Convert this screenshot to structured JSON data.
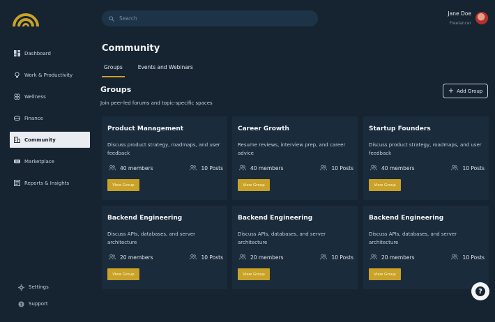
{
  "brand": {
    "accent": "#c9a227",
    "background": "#162432",
    "card": "#1a2b3b"
  },
  "sidebar": {
    "items": [
      {
        "label": "Dashboard",
        "icon": "dashboard-icon"
      },
      {
        "label": "Work & Productivity",
        "icon": "lightbulb-icon"
      },
      {
        "label": "Wellness",
        "icon": "wellness-icon"
      },
      {
        "label": "Finance",
        "icon": "finance-icon"
      },
      {
        "label": "Community",
        "icon": "community-icon"
      },
      {
        "label": "Marketplace",
        "icon": "marketplace-icon"
      },
      {
        "label": "Reports & Insights",
        "icon": "reports-icon"
      }
    ],
    "active": "Community",
    "bottom": [
      {
        "label": "Settings",
        "icon": "gear-icon"
      },
      {
        "label": "Support",
        "icon": "support-icon"
      }
    ]
  },
  "search": {
    "placeholder": "Search"
  },
  "user": {
    "name": "Jane Doe",
    "role": "Freelancer"
  },
  "page": {
    "title": "Community"
  },
  "tabs": [
    {
      "label": "Groups",
      "active": true
    },
    {
      "label": "Events and Webinars",
      "active": false
    }
  ],
  "section": {
    "title": "Groups",
    "subtitle": "Join peer-led forums and topic-specific spaces",
    "add_label": "Add Group"
  },
  "groups": [
    {
      "title": "Product Management",
      "description": "Discuss product strategy, roadmaps, and user feedback",
      "members": "40 members",
      "posts": "10 Posts",
      "button": "View Group"
    },
    {
      "title": "Career Growth",
      "description": "Resume reviews, interview prep, and career advice",
      "members": "40 members",
      "posts": "10 Posts",
      "button": "View Group"
    },
    {
      "title": "Startup Founders",
      "description": "Discuss product strategy, roadmaps, and user feedback",
      "members": "40 members",
      "posts": "10 Posts",
      "button": "View Group"
    },
    {
      "title": "Backend Engineering",
      "description": "Discuss APIs, databases, and server architecture",
      "members": "20 members",
      "posts": "10 Posts",
      "button": "View Group"
    },
    {
      "title": "Backend Engineering",
      "description": "Discuss APIs, databases, and server architecture",
      "members": "20 members",
      "posts": "10 Posts",
      "button": "View Group"
    },
    {
      "title": "Backend Engineering",
      "description": "Discuss APIs, databases, and server architecture",
      "members": "20 members",
      "posts": "10 Posts",
      "button": "View Group"
    }
  ],
  "help": {
    "glyph": "?"
  }
}
